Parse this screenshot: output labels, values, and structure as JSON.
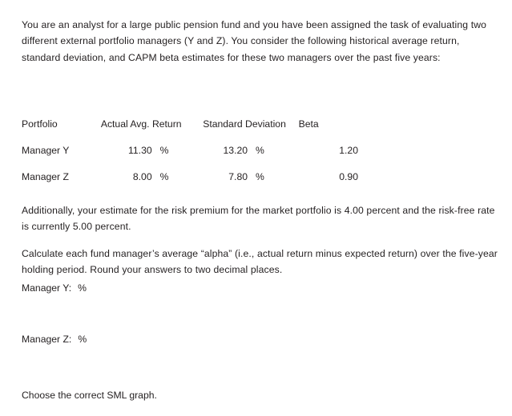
{
  "document": {
    "intro_paragraph": "You are an analyst for a large public pension fund and you have been assigned the task of evaluating two different external portfolio managers (Y and Z). You consider the following historical average return, standard deviation, and CAPM beta estimates for these two managers over the past five years:",
    "risk_premium_paragraph": "Additionally, your estimate for the risk premium for the market portfolio is 4.00 percent and the risk-free rate is currently 5.00 percent.",
    "calculate_paragraph": "Calculate each fund manager’s average “alpha” (i.e., actual return minus expected return) over the five-year holding period. Round your answers to two decimal places.",
    "choose_graph_prompt": "Choose the correct SML graph."
  },
  "table": {
    "headers": {
      "portfolio": "Portfolio",
      "actual_avg_return": "Actual Avg. Return",
      "standard_deviation": "Standard Deviation",
      "beta": "Beta"
    },
    "rows": [
      {
        "portfolio": "Manager Y",
        "actual_avg_return": "11.30",
        "actual_avg_return_unit": "%",
        "standard_deviation": "13.20",
        "standard_deviation_unit": "%",
        "beta": "1.20"
      },
      {
        "portfolio": "Manager Z",
        "actual_avg_return": "8.00",
        "actual_avg_return_unit": "%",
        "standard_deviation": "7.80",
        "standard_deviation_unit": "%",
        "beta": "0.90"
      }
    ]
  },
  "answers": {
    "manager_y": {
      "label": "Manager Y:",
      "value": "",
      "unit": "%"
    },
    "manager_z": {
      "label": "Manager Z:",
      "value": "",
      "unit": "%"
    }
  }
}
